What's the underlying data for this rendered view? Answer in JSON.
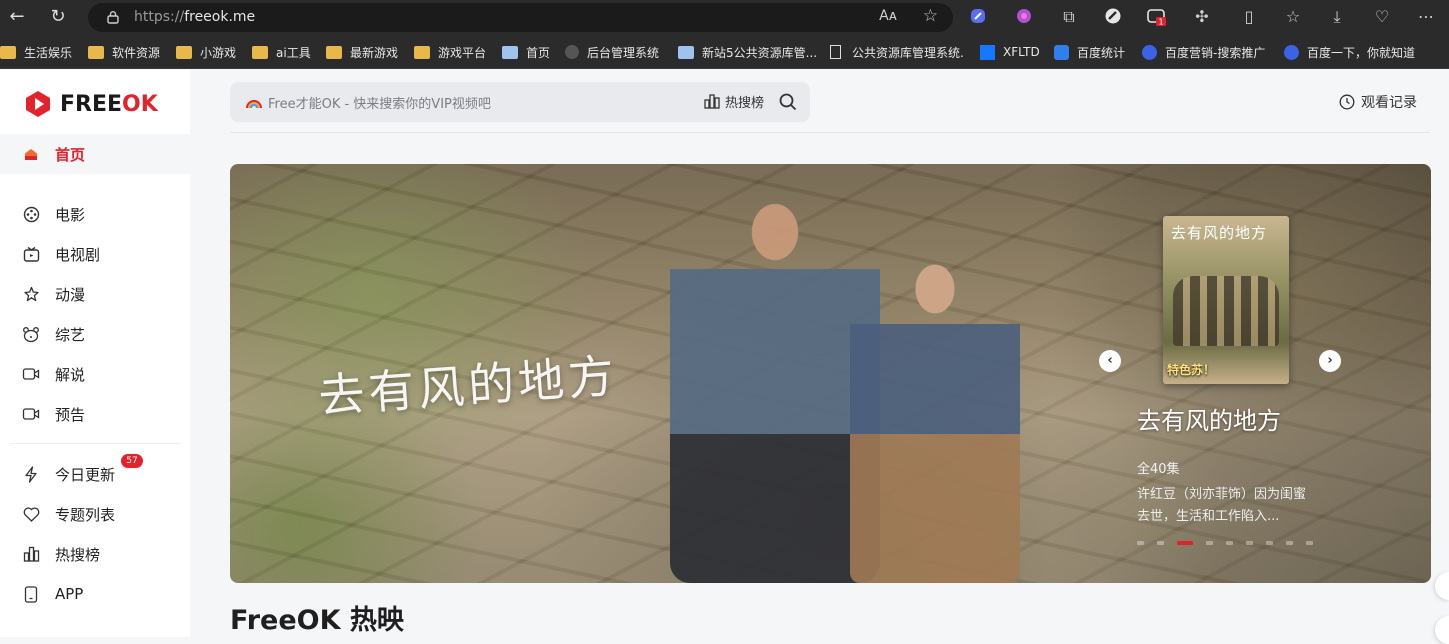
{
  "browser": {
    "url_protocol": "https://",
    "url_host": "freeok.me",
    "read_aloud_label": "Aᴀ",
    "ext_badge": "1"
  },
  "bookmarks": [
    {
      "label": "生活娱乐",
      "icon": "folder-icon"
    },
    {
      "label": "软件资源",
      "icon": "folder-icon"
    },
    {
      "label": "小游戏",
      "icon": "folder-icon"
    },
    {
      "label": "ai工具",
      "icon": "folder-icon"
    },
    {
      "label": "最新游戏",
      "icon": "folder-icon"
    },
    {
      "label": "游戏平台",
      "icon": "folder-icon"
    },
    {
      "label": "首页",
      "icon": "page-icon"
    },
    {
      "label": "后台管理系统",
      "icon": "cog-icon"
    },
    {
      "label": "新站5公共资源库管...",
      "icon": "page-icon"
    },
    {
      "label": "公共资源库管理系统.",
      "icon": "document-icon"
    },
    {
      "label": "XFLTD",
      "icon": "xfltd-icon"
    },
    {
      "label": "百度统计",
      "icon": "baidu-stats-icon"
    },
    {
      "label": "百度营销-搜索推广",
      "icon": "baidu-paw-icon"
    },
    {
      "label": "百度一下，你就知道",
      "icon": "baidu-paw-icon"
    }
  ],
  "brand": {
    "free": "FREE",
    "ok": "OK",
    "accent": "#e3232c"
  },
  "sidebar": {
    "home": "首页",
    "items": [
      {
        "label": "电影",
        "icon": "film-reel-icon"
      },
      {
        "label": "电视剧",
        "icon": "tv-icon"
      },
      {
        "label": "动漫",
        "icon": "anime-star-icon"
      },
      {
        "label": "综艺",
        "icon": "bear-icon"
      },
      {
        "label": "解说",
        "icon": "video-camera-icon"
      },
      {
        "label": "预告",
        "icon": "video-camera-icon"
      }
    ],
    "secondary": [
      {
        "label": "今日更新",
        "icon": "lightning-icon"
      },
      {
        "label": "专题列表",
        "icon": "heart-icon"
      },
      {
        "label": "热搜榜",
        "icon": "bar-chart-icon"
      },
      {
        "label": "APP",
        "icon": "phone-icon"
      }
    ],
    "update_badge": "57"
  },
  "search": {
    "placeholder": "Free才能OK - 快来搜索你的VIP视频吧",
    "hot_label": "热搜榜"
  },
  "header": {
    "history_label": "观看记录"
  },
  "hero": {
    "calligraphy": "去有风的地方",
    "poster_title": "去有风的地方",
    "poster_subtitle": "特色苏！",
    "title": "去有风的地方",
    "episodes": "全40集",
    "description": "许红豆（刘亦菲饰）因为闺蜜去世，生活和工作陷入...",
    "slide_count": 9,
    "active_slide": 2
  },
  "section": {
    "title": "FreeOK 热映"
  }
}
